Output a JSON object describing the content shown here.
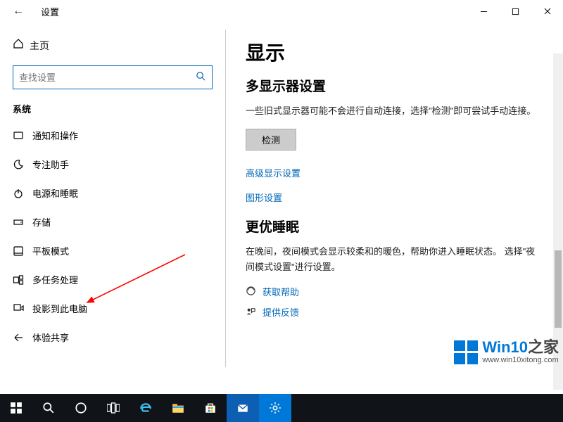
{
  "titlebar": {
    "title": "设置"
  },
  "sidebar": {
    "home": "主页",
    "search_placeholder": "查找设置",
    "group": "系统",
    "items": [
      {
        "label": "通知和操作"
      },
      {
        "label": "专注助手"
      },
      {
        "label": "电源和睡眠"
      },
      {
        "label": "存储"
      },
      {
        "label": "平板模式"
      },
      {
        "label": "多任务处理"
      },
      {
        "label": "投影到此电脑"
      },
      {
        "label": "体验共享"
      }
    ]
  },
  "content": {
    "h1": "显示",
    "h2a": "多显示器设置",
    "para1": "一些旧式显示器可能不会进行自动连接，选择\"检测\"即可尝试手动连接。",
    "detect_btn": "检测",
    "link1": "高级显示设置",
    "link2": "图形设置",
    "h2b": "更优睡眠",
    "para2": "在晚间，夜间模式会显示较柔和的暖色，帮助你进入睡眠状态。 选择\"夜间模式设置\"进行设置。",
    "help": "获取帮助",
    "feedback": "提供反馈"
  },
  "watermark": {
    "brand_a": "Win10",
    "brand_b": "之家",
    "url": "www.win10xitong.com"
  }
}
